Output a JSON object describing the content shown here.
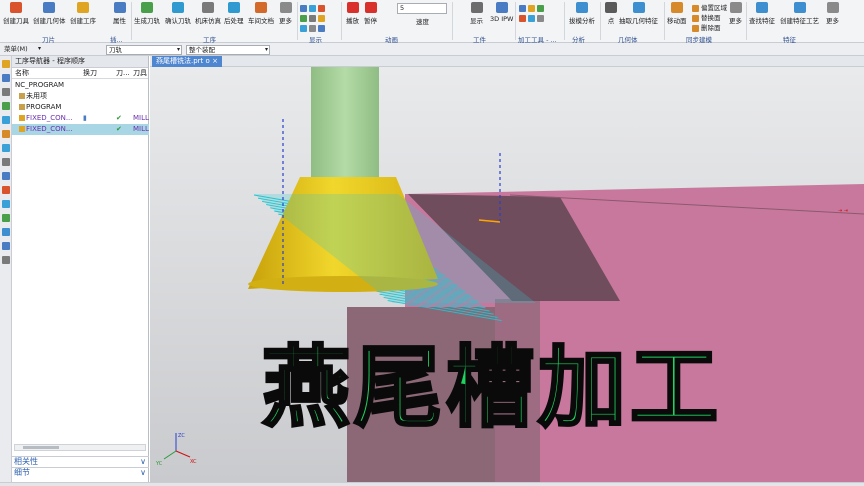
{
  "ribbon": {
    "tools": [
      {
        "label": "创建刀具",
        "color": "#d9532c"
      },
      {
        "label": "创建几何体",
        "color": "#4a7cc3"
      },
      {
        "label": "创建工序",
        "color": "#e0a423"
      },
      {
        "label": "属性",
        "color": "#4a7cc3"
      },
      {
        "label": "生成刀轨",
        "color": "#4a9f4a"
      },
      {
        "label": "确认刀轨",
        "color": "#2e9ad0"
      },
      {
        "label": "机床仿真",
        "color": "#7a7a7a"
      },
      {
        "label": "后处理",
        "color": "#2e9ad0"
      },
      {
        "label": "车间文档",
        "color": "#d36a2a"
      },
      {
        "label": "更多",
        "color": "#8a8a8a"
      },
      {
        "label": "播放",
        "color": "#d9302c"
      },
      {
        "label": "暂停",
        "color": "#d9302c"
      },
      {
        "label": "显示",
        "color": "#6d6d6d"
      },
      {
        "label": "3D IPW",
        "color": "#4a7cc3"
      },
      {
        "label": "拔模分析",
        "color": "#3e8fcf"
      },
      {
        "label": "点",
        "color": "#5a5a5a"
      },
      {
        "label": "抽取几何特征",
        "color": "#3e8fcf"
      },
      {
        "label": "移动面",
        "color": "#d78a2a"
      },
      {
        "label": "更多",
        "color": "#8a8a8a"
      },
      {
        "label": "查找特征",
        "color": "#3e8fcf"
      },
      {
        "label": "创建特征工艺",
        "color": "#3e8fcf"
      },
      {
        "label": "更多",
        "color": "#8a8a8a"
      }
    ],
    "small_items": [
      "偏置区域",
      "替换面",
      "删除面"
    ],
    "speed_value": "5",
    "speed_label": "速度",
    "groups": [
      "刀片",
      "插...",
      "工序",
      "显示",
      "动画",
      "工件",
      "加工工具 - ...",
      "分析",
      "几何体",
      "同步建模",
      "特征"
    ]
  },
  "subbar": {
    "menu": "菜单(M)",
    "filter": "刀轨",
    "scope": "整个装配"
  },
  "navigator": {
    "title": "工序导航器 - 程序顺序",
    "columns": [
      "名称",
      "换刀",
      "刀...",
      "刀具"
    ],
    "rows": [
      {
        "name": "NC_PROGRAM",
        "change": "",
        "check": "",
        "tool": ""
      },
      {
        "name": "未用项",
        "change": "",
        "check": "",
        "tool": ""
      },
      {
        "name": "PROGRAM",
        "change": "",
        "check": "",
        "tool": ""
      },
      {
        "name": "FIXED_CON...",
        "change": "▮",
        "check": "✔",
        "tool": "MILL"
      },
      {
        "name": "FIXED_CON...",
        "change": "",
        "check": "✔",
        "tool": "MILL"
      }
    ],
    "sections": [
      "相关性",
      "细节"
    ]
  },
  "viewport": {
    "tab_label": "燕尾槽铣法.prt",
    "tab_flag": "o",
    "tab_close": "×",
    "overlay_text": "燕尾槽加工",
    "axis_labels": [
      "ZC",
      "YC",
      "XC"
    ]
  },
  "colors": {
    "shank": "#a3cf95",
    "cutter": "#e6c41a",
    "stock": "#c9789d",
    "part": "#8c6877",
    "toolpath": "#1cc6d2",
    "overlay": "#1fd35f"
  }
}
